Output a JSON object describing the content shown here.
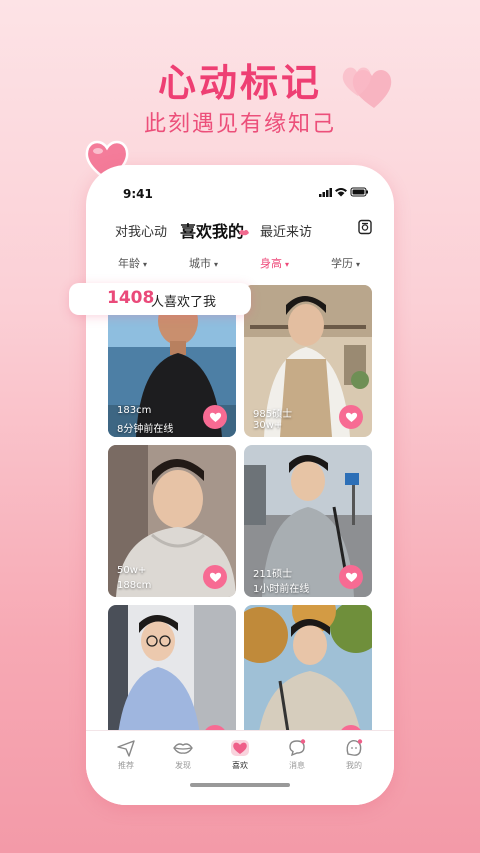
{
  "banner": {
    "title": "心动标记",
    "subtitle": "此刻遇见有缘知己"
  },
  "status_bar": {
    "time": "9:41"
  },
  "tabs": [
    {
      "label": "对我心动",
      "active": false
    },
    {
      "label": "喜欢我的",
      "active": true
    },
    {
      "label": "最近来访",
      "active": false
    }
  ],
  "filters": [
    {
      "label": "年龄",
      "active": false
    },
    {
      "label": "城市",
      "active": false
    },
    {
      "label": "身高",
      "active": true
    },
    {
      "label": "学历",
      "active": false
    }
  ],
  "likes": {
    "count": "1408",
    "text": "人喜欢了我"
  },
  "cards": [
    {
      "line1": "183cm",
      "line2": "8分钟前在线"
    },
    {
      "line1": "985硕士",
      "line2": "30w+"
    },
    {
      "line1": "50w+",
      "line2": "188cm"
    },
    {
      "line1": "211硕士",
      "line2": "1小时前在线"
    },
    {
      "line1": "",
      "line2": ""
    },
    {
      "line1": "",
      "line2": ""
    }
  ],
  "nav": [
    {
      "label": "推荐",
      "icon": "paper-plane-icon",
      "active": false
    },
    {
      "label": "发现",
      "icon": "lips-icon",
      "active": false
    },
    {
      "label": "喜欢",
      "icon": "heart-icon",
      "active": true
    },
    {
      "label": "消息",
      "icon": "chat-bubble-icon",
      "active": false
    },
    {
      "label": "我的",
      "icon": "profile-face-icon",
      "active": false
    }
  ],
  "colors": {
    "accent": "#ee3f73",
    "like_button": "#f76b93",
    "background_top": "#fde3e6",
    "background_bottom": "#f39aa8"
  }
}
